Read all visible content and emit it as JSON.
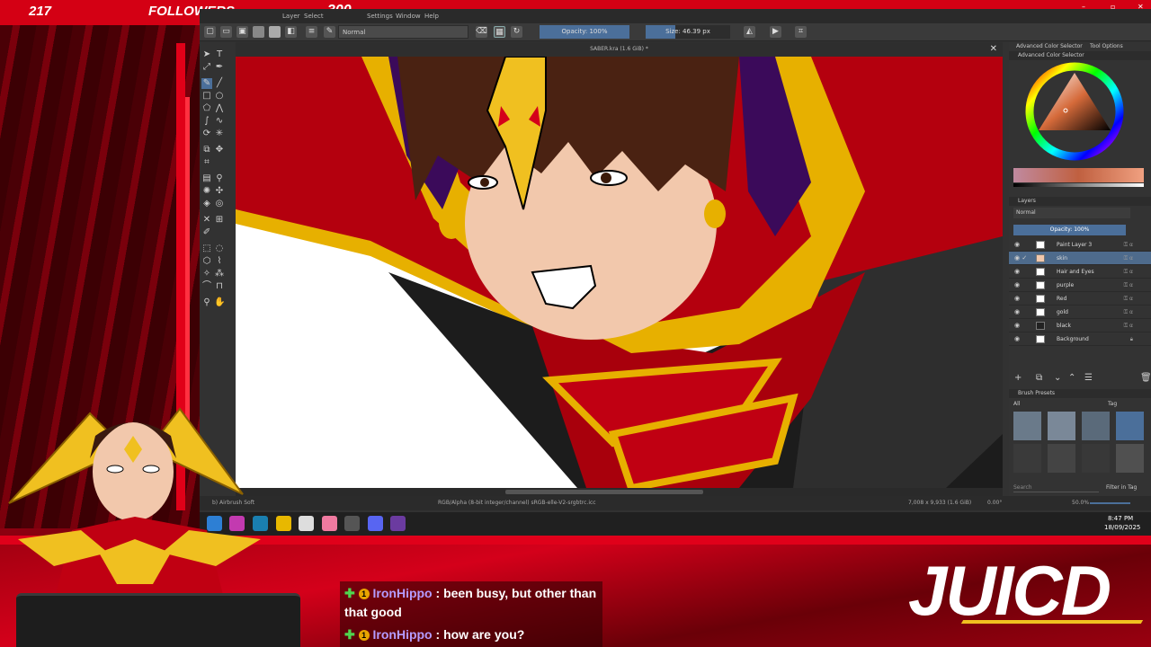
{
  "overlay": {
    "followers_count": "217",
    "followers_label": "FOLLOWERS",
    "followers_goal": "300",
    "brand": "JUICD"
  },
  "krita": {
    "menu": [
      "Layer",
      "Select",
      "Settings",
      "Window",
      "Help"
    ],
    "blend_mode": "Normal",
    "opacity_label": "Opacity: 100%",
    "size_label": "Size: 46.39 px",
    "doc_title": "SABER.kra (1.6 GiB) *",
    "status": {
      "brush": "b) Airbrush Soft",
      "color_space": "RGB/Alpha (8-bit integer/channel)  sRGB-elle-V2-srgbtrc.icc",
      "doc_size": "7,008 x 9,933 (1.6 GiB)",
      "rotation": "0.00°",
      "zoom": "50.0%"
    },
    "dock_tabs": [
      "Advanced Color Selector",
      "Tool Options"
    ],
    "color_selector_title": "Advanced Color Selector",
    "layers_title": "Layers",
    "layers_blend": "Normal",
    "layers_opacity": "Opacity:  100%",
    "layers": [
      "Paint Layer 3",
      "skin",
      "Hair and Eyes",
      "purple",
      "Red",
      "gold",
      "black",
      "Background"
    ],
    "active_layer": "skin",
    "brush_presets_title": "Brush Presets",
    "brush_filter": "All",
    "brush_tag": "Tag",
    "search_placeholder": "Search",
    "filter_in_tag": "Filter in Tag"
  },
  "taskbar": {
    "time": "8:47 PM",
    "date": "18/09/2025"
  },
  "chat": [
    {
      "user": "IronHippo",
      "message": ": been busy, but other than",
      "message_cont": "that good"
    },
    {
      "user": "IronHippo",
      "message": ": how are you?"
    }
  ],
  "colors": {
    "accent_red": "#d40014",
    "krita_blue": "#4b6f9a",
    "chat_user": "#b59cff"
  }
}
